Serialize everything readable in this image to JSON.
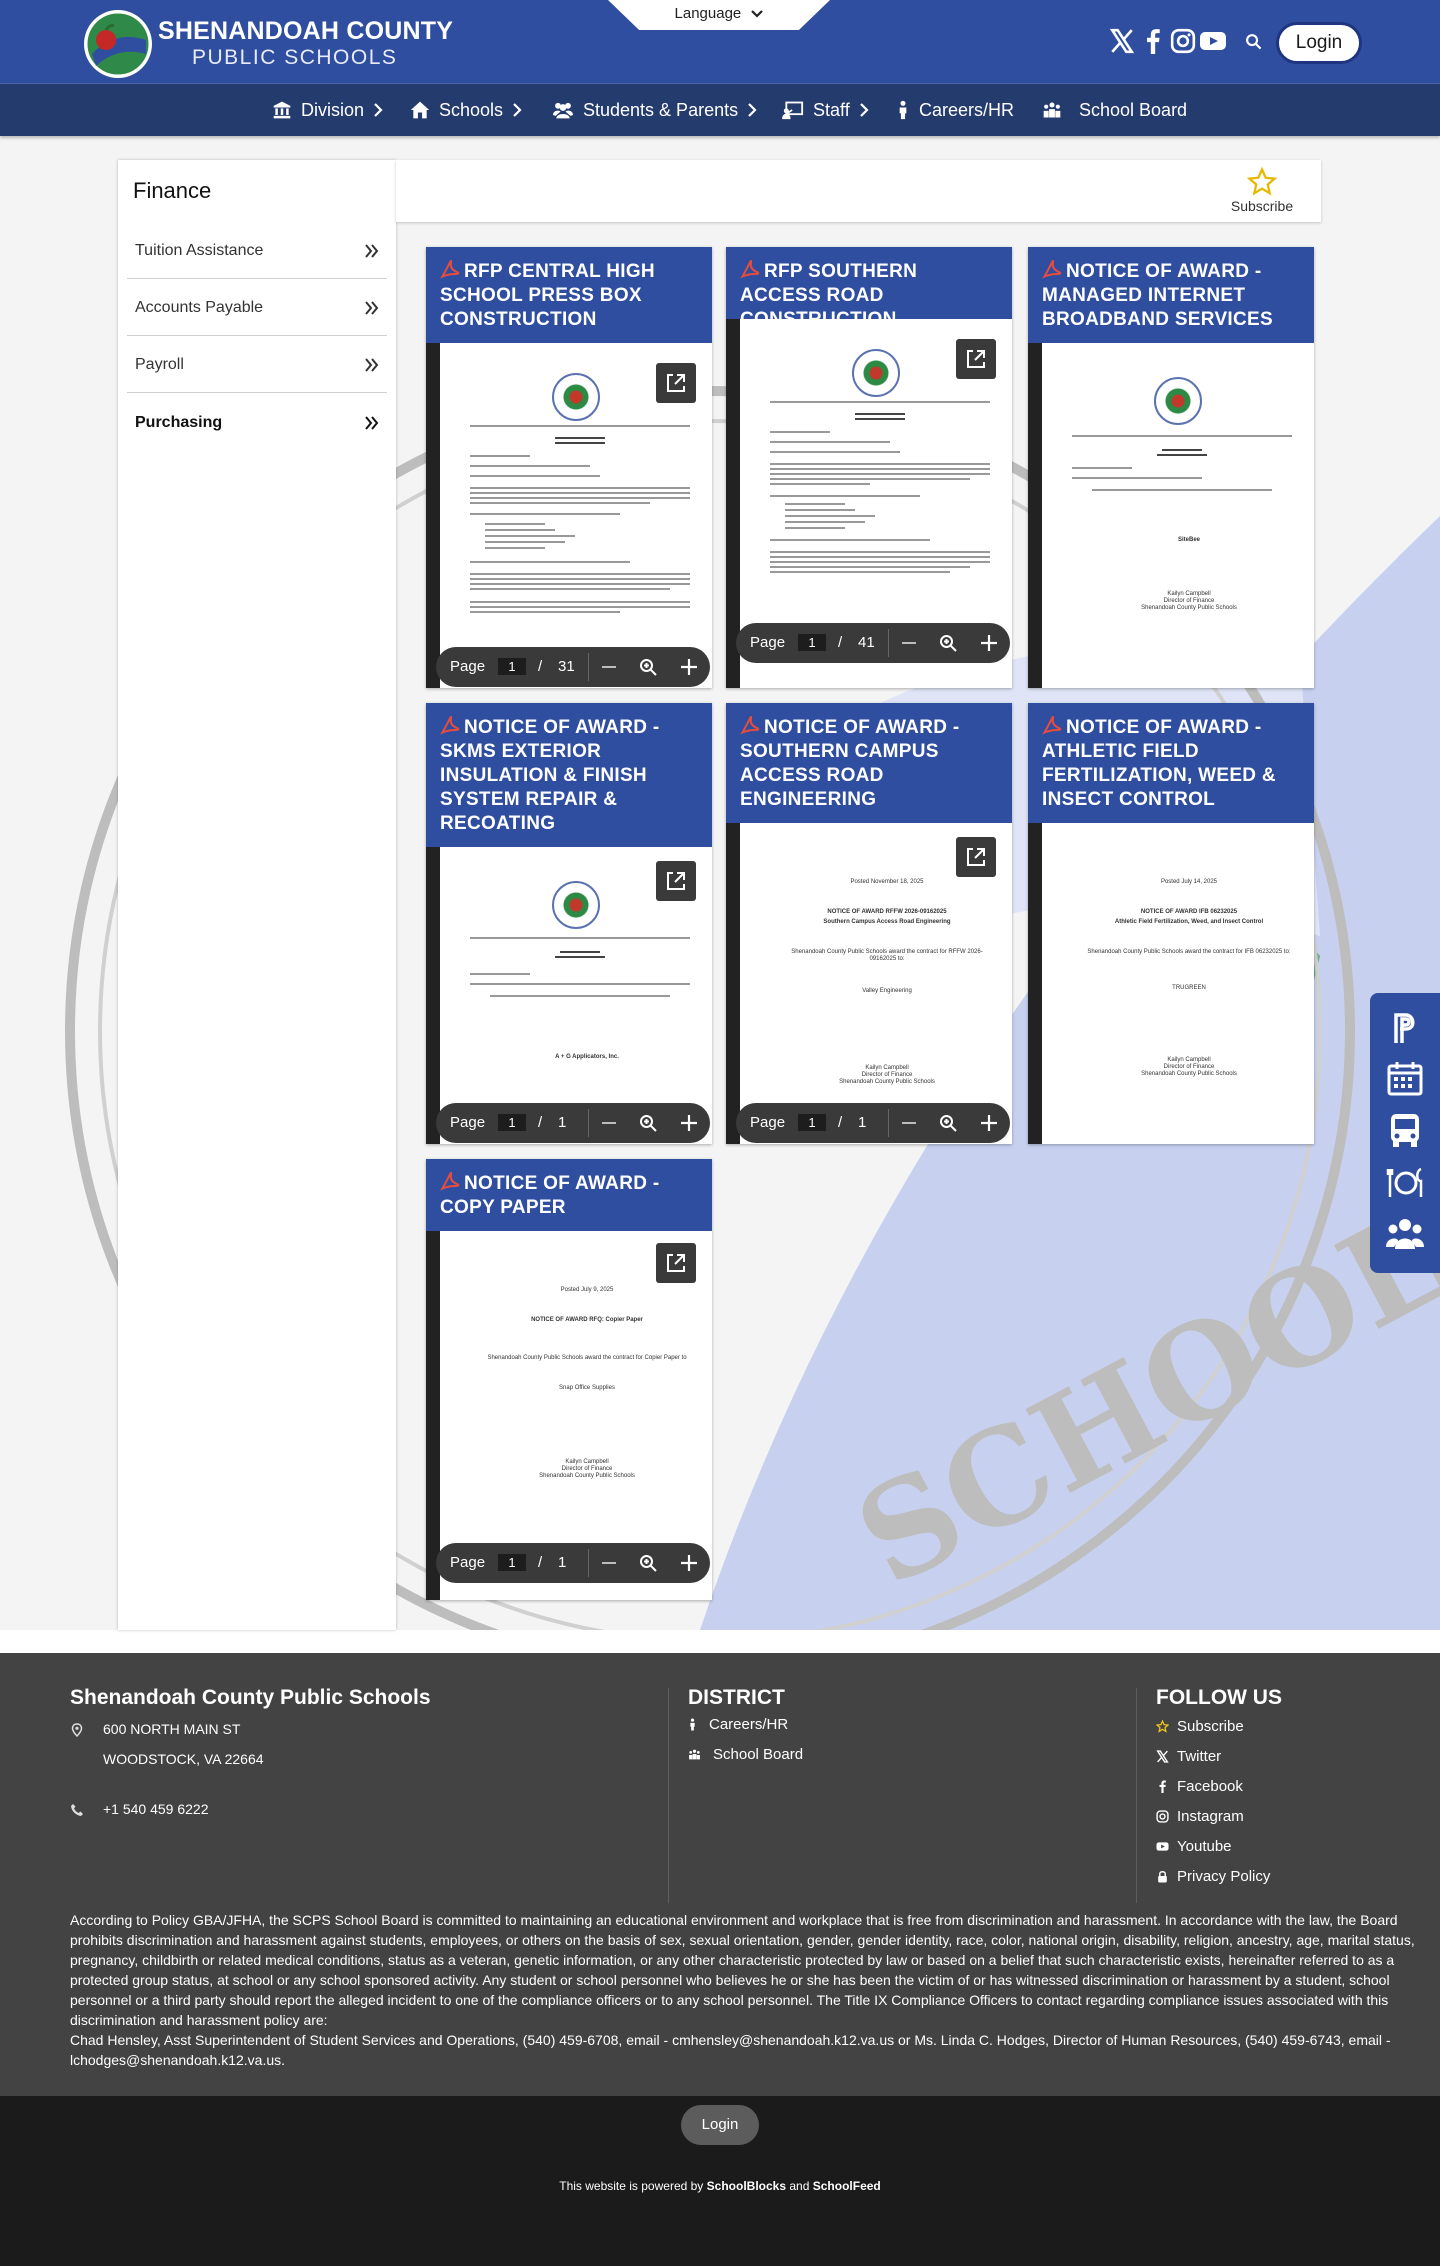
{
  "header": {
    "logo_line1": "SHENANDOAH COUNTY",
    "logo_line2": "PUBLIC SCHOOLS",
    "language_label": "Language",
    "login_label": "Login"
  },
  "nav": {
    "items": [
      {
        "label": "Division",
        "icon": "building-icon",
        "has_chevron": true
      },
      {
        "label": "Schools",
        "icon": "home-icon",
        "has_chevron": true
      },
      {
        "label": "Students & Parents",
        "icon": "users-icon",
        "has_chevron": true
      },
      {
        "label": "Staff",
        "icon": "chalkboard-icon",
        "has_chevron": true
      },
      {
        "label": "Careers/HR",
        "icon": "person-icon",
        "has_chevron": false
      },
      {
        "label": "School Board",
        "icon": "group-icon",
        "has_chevron": false
      }
    ]
  },
  "page": {
    "title": "Finance",
    "subscribe_label": "Subscribe"
  },
  "sidebar": {
    "items": [
      {
        "label": "Tuition Assistance",
        "active": false
      },
      {
        "label": "Accounts Payable",
        "active": false
      },
      {
        "label": "Payroll",
        "active": false
      },
      {
        "label": "Purchasing",
        "active": true
      }
    ]
  },
  "cards": [
    {
      "title": "RFP CENTRAL HIGH SCHOOL PRESS BOX CONSTRUCTION",
      "page_label": "Page",
      "page": "1",
      "total": "31"
    },
    {
      "title": "RFP SOUTHERN ACCESS ROAD CONSTRUCTION",
      "page_label": "Page",
      "page": "1",
      "total": "41"
    },
    {
      "title": "NOTICE OF AWARD - MANAGED INTERNET BROADBAND SERVICES"
    },
    {
      "title": "NOTICE OF AWARD - SKMS EXTERIOR INSULATION & FINISH SYSTEM REPAIR & RECOATING",
      "page_label": "Page",
      "page": "1",
      "total": "1"
    },
    {
      "title": "NOTICE OF AWARD - SOUTHERN CAMPUS ACCESS ROAD ENGINEERING",
      "page_label": "Page",
      "page": "1",
      "total": "1"
    },
    {
      "title": "NOTICE OF AWARD - ATHLETIC FIELD FERTILIZATION, WEED & INSECT CONTROL"
    },
    {
      "title": "NOTICE OF AWARD - COPY PAPER",
      "page_label": "Page",
      "page": "1",
      "total": "1"
    }
  ],
  "doc_text": {
    "posted_nov": "Posted November 18, 2025",
    "rffw_title": "NOTICE OF AWARD RFFW 2026-09162025",
    "rffw_sub": "Southern Campus Access Road Engineering",
    "rffw_body": "Shenandoah County Public Schools award the contract for RFFW 2026-09162025 to:",
    "rffw_vendor": "Valley Engineering",
    "posted_jul14": "Posted July 14, 2025",
    "ifb_title": "NOTICE OF AWARD IFB 06232025",
    "ifb_sub": "Athletic Field Fertilization, Weed, and Insect Control",
    "ifb_body": "Shenandoah County Public Schools award the contract for IFB 06232025 to:",
    "ifb_vendor": "TRUGREEN",
    "posted_jul9": "Posted July 9, 2025",
    "paper_title": "NOTICE OF AWARD RFQ: Copier Paper",
    "paper_body": "Shenandoah County Public Schools award the contract for Copier Paper to",
    "paper_vendor": "Snap Office Supplies",
    "sig_name": "Kailyn Campbell",
    "sig_role": "Director of Finance",
    "sig_org": "Shenandoah County Public Schools",
    "skms_vendor": "A + G Applicators, Inc.",
    "mib_vendor": "SiteBee"
  },
  "footer": {
    "org_name": "Shenandoah County Public Schools",
    "address1": "600 NORTH MAIN ST",
    "address2": "WOODSTOCK, VA 22664",
    "phone": "+1 540 459 6222",
    "district_title": "DISTRICT",
    "district_links": [
      "Careers/HR",
      "School Board"
    ],
    "follow_title": "FOLLOW US",
    "follow_links": [
      "Subscribe",
      "Twitter",
      "Facebook",
      "Instagram",
      "Youtube",
      "Privacy Policy"
    ],
    "policy_text": "According to Policy GBA/JFHA, the SCPS School Board is committed to maintaining an educational environment and workplace that is free from discrimination and harassment. In accordance with the law, the Board prohibits discrimination and harassment against students, employees, or others on the basis of sex, sexual orientation, gender, gender identity, race, color, national origin, disability, religion, ancestry, age, marital status, pregnancy, childbirth or related medical conditions, status as a veteran, genetic information, or any other characteristic protected by law or based on a belief that such characteristic exists, hereinafter referred to as a protected group status, at school or any school sponsored activity. Any student or school personnel who believes he or she has been the victim of or has witnessed discrimination or harassment by a student, school personnel or a third party should report the alleged incident to one of the compliance officers or to any school personnel. The Title IX Compliance Officers to contact regarding compliance issues associated with this discrimination and harassment policy are:",
    "policy_contacts": "Chad Hensley, Asst Superintendent of Student Services and Operations, (540) 459-6708, email - cmhensley@shenandoah.k12.va.us or Ms. Linda C. Hodges, Director of Human Resources, (540) 459-6743, email - lchodges@shenandoah.k12.va.us.",
    "bottom_login": "Login",
    "powered_prefix": "This website is powered by",
    "powered_a": "SchoolBlocks",
    "powered_and": "and",
    "powered_b": "SchoolFeed"
  },
  "colors": {
    "brand_blue": "#2f4ea0",
    "nav_dark": "#243b6e",
    "footer_gray": "#434343",
    "bottom_black": "#1b1b1b",
    "star_gold": "#f0c419"
  }
}
